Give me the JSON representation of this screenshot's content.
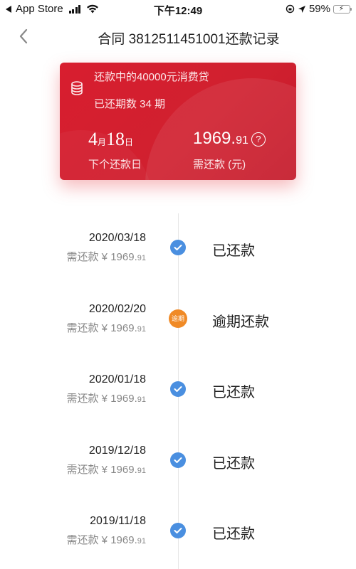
{
  "status_bar": {
    "back_app": "App Store",
    "time": "下午12:49",
    "battery_percent": "59%",
    "battery_level": 0.59
  },
  "nav": {
    "title": "合同 3812511451001还款记录"
  },
  "summary_card": {
    "loan_desc": "还款中的40000元消费贷",
    "paid_periods": "已还期数 34 期",
    "next_date_month": "4",
    "next_date_month_unit": "月",
    "next_date_day": "18",
    "next_date_day_unit": "日",
    "next_date_label": "下个还款日",
    "amount_int": "1969.",
    "amount_cents": "91",
    "help_icon": "?",
    "amount_label": "需还款 (元)"
  },
  "records": [
    {
      "date": "2020/03/18",
      "amount_prefix": "需还款 ¥ ",
      "amount_int": "1969.",
      "amount_cents": "91",
      "status": "已还款",
      "type": "paid"
    },
    {
      "date": "2020/02/20",
      "amount_prefix": "需还款 ¥ ",
      "amount_int": "1969.",
      "amount_cents": "91",
      "status": "逾期还款",
      "type": "overdue",
      "badge": "逾期"
    },
    {
      "date": "2020/01/18",
      "amount_prefix": "需还款 ¥ ",
      "amount_int": "1969.",
      "amount_cents": "91",
      "status": "已还款",
      "type": "paid"
    },
    {
      "date": "2019/12/18",
      "amount_prefix": "需还款 ¥ ",
      "amount_int": "1969.",
      "amount_cents": "91",
      "status": "已还款",
      "type": "paid"
    },
    {
      "date": "2019/11/18",
      "amount_prefix": "需还款 ¥ ",
      "amount_int": "1969.",
      "amount_cents": "91",
      "status": "已还款",
      "type": "paid"
    }
  ],
  "colors": {
    "card_red": "#d81e2f",
    "paid_blue": "#4a8fe0",
    "overdue_orange": "#f08a26"
  }
}
